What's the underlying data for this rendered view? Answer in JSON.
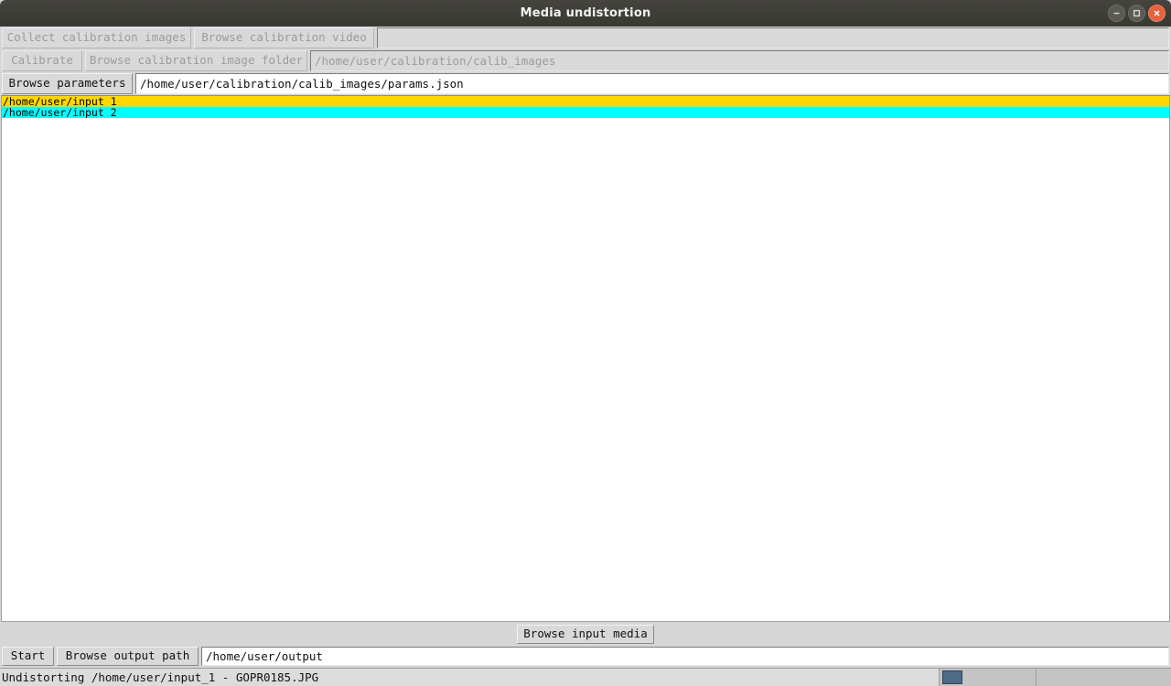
{
  "window": {
    "title": "Media undistortion",
    "controls": [
      {
        "name": "minimize-button",
        "glyph": "minimize"
      },
      {
        "name": "maximize-button",
        "glyph": "maximize"
      },
      {
        "name": "close-button",
        "glyph": "close"
      }
    ]
  },
  "toolbar": {
    "row1": {
      "collect_button": "Collect calibration images",
      "collect_enabled": false,
      "browse_video_button": "Browse calibration video",
      "browse_video_enabled": false,
      "video_path_value": "",
      "video_path_enabled": false
    },
    "row2": {
      "calibrate_button": "Calibrate",
      "calibrate_enabled": false,
      "browse_folder_button": "Browse calibration image folder",
      "browse_folder_enabled": false,
      "folder_path_value": "/home/user/calibration/calib_images",
      "folder_path_enabled": false
    },
    "row3": {
      "browse_parameters_button": "Browse parameters",
      "browse_parameters_enabled": true,
      "parameters_path_value": "/home/user/calibration/calib_images/params.json",
      "parameters_path_enabled": true
    }
  },
  "input_list": {
    "items": [
      {
        "label": "/home/user/input_1",
        "highlight": "#ffd700"
      },
      {
        "label": "/home/user/input_2",
        "highlight": "#00ffff"
      }
    ]
  },
  "bottom": {
    "browse_input_media_button": "Browse input media",
    "start_button": "Start",
    "browse_output_path_button": "Browse output path",
    "output_path_value": "/home/user/output"
  },
  "statusbar": {
    "message": "Undistorting /home/user/input_1 - GOPR0185.JPG",
    "progress_percent": 20,
    "progress_chunk_color": "#4d6a86"
  },
  "colors": {
    "titlebar": "#3c3b37",
    "panel": "#d6d6d6",
    "highlight_yellow": "#ffd700",
    "highlight_cyan": "#00ffff",
    "close_button": "#e8613c"
  }
}
